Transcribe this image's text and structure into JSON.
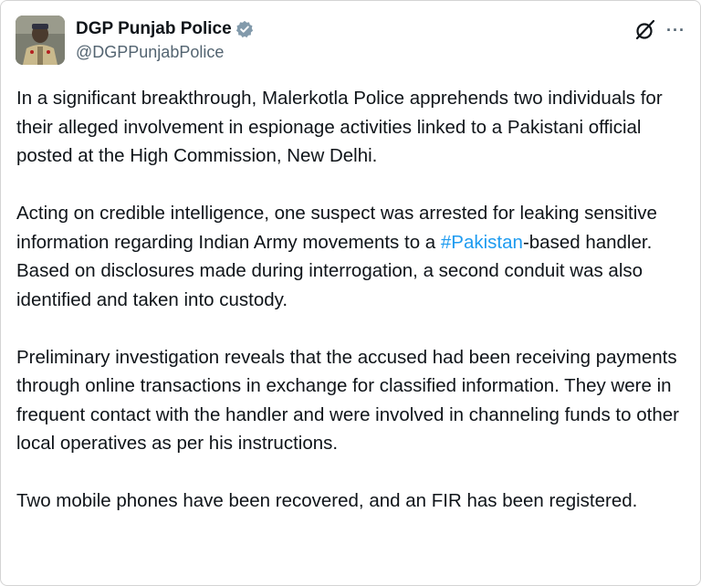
{
  "account": {
    "display_name": "DGP Punjab Police",
    "handle": "@DGPPunjabPolice",
    "verified": true,
    "avatar_icon": "avatar-officer-photo"
  },
  "actions": {
    "grok_icon": "grok-icon",
    "more_icon": "more-options-icon",
    "more_label": "···"
  },
  "colors": {
    "text": "#0f1419",
    "secondary": "#536471",
    "link": "#1d9bf0",
    "verified_badge": "#829aab"
  },
  "post": {
    "p1": "In a significant breakthrough, Malerkotla Police apprehends two individuals for their alleged involvement in espionage activities linked to a Pakistani official posted at the High Commission, New Delhi.",
    "p2_before": "Acting on credible intelligence, one suspect was arrested for leaking sensitive information regarding Indian Army movements to a ",
    "p2_hashtag": "#Pakistan",
    "p2_after": "-based handler. Based on disclosures made during interrogation, a second conduit was also identified and taken into custody.",
    "p3": "Preliminary investigation reveals that the accused had been receiving payments through online transactions in exchange for classified information. They were in frequent contact with the handler and were involved in channeling funds to other local operatives as per his instructions.",
    "p4": "Two mobile phones have been recovered, and an FIR has been registered."
  }
}
